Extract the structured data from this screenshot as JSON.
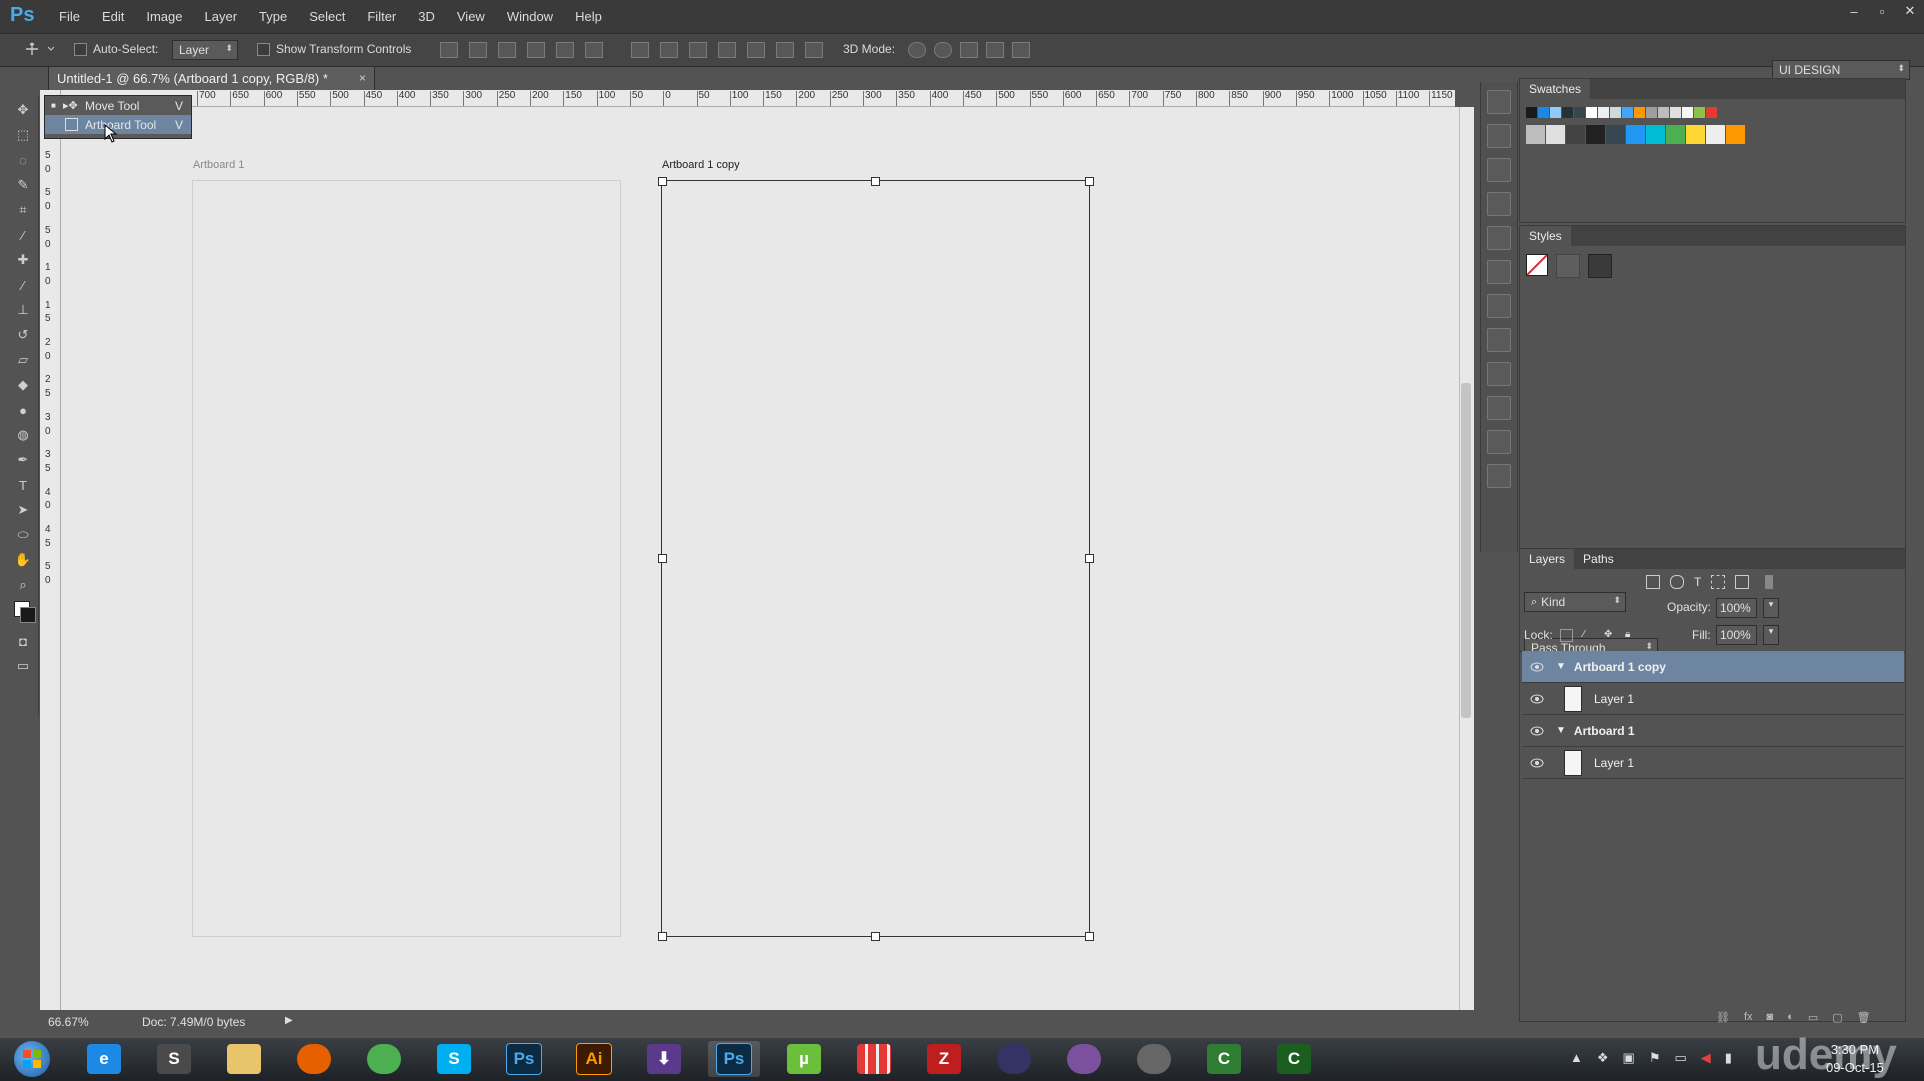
{
  "app": {
    "name": "Ps",
    "brand_color": "#4fa8e8"
  },
  "menubar": {
    "items": [
      "File",
      "Edit",
      "Image",
      "Layer",
      "Type",
      "Select",
      "Filter",
      "3D",
      "View",
      "Window",
      "Help"
    ],
    "window_controls": {
      "minimize": "–",
      "maximize": "▫",
      "close": "✕"
    }
  },
  "options": {
    "auto_select_label": "Auto-Select:",
    "auto_select_value": "Layer",
    "show_transform_label": "Show Transform Controls",
    "mode_3d_label": "3D Mode:",
    "workspace": "UI DESIGN"
  },
  "document": {
    "tab_title": "Untitled-1 @ 66.7% (Artboard 1 copy, RGB/8) *",
    "close": "×"
  },
  "ruler": {
    "h_ticks": [
      "700",
      "650",
      "600",
      "550",
      "500",
      "450",
      "400",
      "350",
      "300",
      "250",
      "200",
      "150",
      "100",
      "50",
      "0",
      "50",
      "100",
      "150",
      "200",
      "250",
      "300",
      "350",
      "400",
      "450",
      "500",
      "550",
      "600",
      "650",
      "700",
      "750",
      "800",
      "850",
      "900",
      "950",
      "1000",
      "1050",
      "1100",
      "1150"
    ],
    "v_ticks": [
      "5",
      "0",
      "5",
      "0",
      "5",
      "0",
      "1",
      "0",
      "1",
      "5",
      "2",
      "0",
      "2",
      "5",
      "3",
      "0",
      "3",
      "5",
      "4",
      "0",
      "4",
      "5",
      "5",
      "0"
    ]
  },
  "flyout": {
    "items": [
      {
        "label": "Move Tool",
        "shortcut": "V",
        "selected": false
      },
      {
        "label": "Artboard Tool",
        "shortcut": "V",
        "selected": true
      }
    ]
  },
  "artboards": [
    {
      "label": "Artboard 1",
      "selected": false
    },
    {
      "label": "Artboard 1 copy",
      "selected": true
    }
  ],
  "status": {
    "zoom": "66.67%",
    "doc": "Doc: 7.49M/0 bytes"
  },
  "panels": {
    "swatches_title": "Swatches",
    "swatches_row1": [
      "#1a1a1a",
      "#1e88e5",
      "#90caf9",
      "#263238",
      "#37474f",
      "#ffffff",
      "#eceff1",
      "#cfd8dc",
      "#42a5f5",
      "#ff9800",
      "#9e9e9e",
      "#bdbdbd",
      "#e0e0e0",
      "#f5f5f5",
      "#8bc34a",
      "#e53935"
    ],
    "swatches_row2": [
      "#bdbdbd",
      "#e0e0e0",
      "#424242",
      "#212121",
      "#37474f",
      "#2196f3",
      "#00bcd4",
      "#4caf50",
      "#fdd835",
      "#eeeeee",
      "#ff9800"
    ],
    "styles_title": "Styles",
    "layers_tabs": [
      "Layers",
      "Paths"
    ],
    "kind_label": "Kind",
    "blend_mode": "Pass Through",
    "opacity_label": "Opacity:",
    "opacity_value": "100%",
    "lock_label": "Lock:",
    "fill_label": "Fill:",
    "fill_value": "100%"
  },
  "layers": [
    {
      "name": "Artboard 1 copy",
      "type": "artboard",
      "selected": true
    },
    {
      "name": "Layer 1",
      "type": "layer",
      "selected": false
    },
    {
      "name": "Artboard 1",
      "type": "artboard",
      "selected": false
    },
    {
      "name": "Layer 1",
      "type": "layer",
      "selected": false
    }
  ],
  "taskbar": {
    "apps": [
      {
        "name": "ie-icon",
        "glyph": "e",
        "color": "#1e88e5"
      },
      {
        "name": "sublime-icon",
        "glyph": "S",
        "color": "#4a4a4a"
      },
      {
        "name": "explorer-icon",
        "glyph": "",
        "color": "#e8c46a"
      },
      {
        "name": "firefox-icon",
        "glyph": "",
        "color": "#e66000"
      },
      {
        "name": "chrome-icon",
        "glyph": "",
        "color": "#4caf50"
      },
      {
        "name": "skype-icon",
        "glyph": "S",
        "color": "#00aff0"
      },
      {
        "name": "photoshop-icon",
        "glyph": "Ps",
        "color": "#0b2a44"
      },
      {
        "name": "illustrator-icon",
        "glyph": "Ai",
        "color": "#3d1a00"
      },
      {
        "name": "download-icon",
        "glyph": "⬇",
        "color": "#5b3a8c"
      },
      {
        "name": "photoshop-icon",
        "glyph": "Ps",
        "color": "#0b2a44"
      },
      {
        "name": "utorrent-icon",
        "glyph": "µ",
        "color": "#6cbf3a"
      },
      {
        "name": "apps-grid-icon",
        "glyph": "",
        "color": "#eeeeee"
      },
      {
        "name": "filezilla-icon",
        "glyph": "Z",
        "color": "#bf1e1e"
      },
      {
        "name": "audio-icon",
        "glyph": "",
        "color": "#333366"
      },
      {
        "name": "viber-icon",
        "glyph": "",
        "color": "#7b519d"
      },
      {
        "name": "webcam-icon",
        "glyph": "",
        "color": "#666666"
      },
      {
        "name": "camtasia-icon",
        "glyph": "C",
        "color": "#2e7d32"
      },
      {
        "name": "camtasia-recorder-icon",
        "glyph": "C",
        "color": "#1b5e20"
      }
    ],
    "time": "3:30 PM",
    "date": "09-Oct-15"
  },
  "watermark": "udemy"
}
